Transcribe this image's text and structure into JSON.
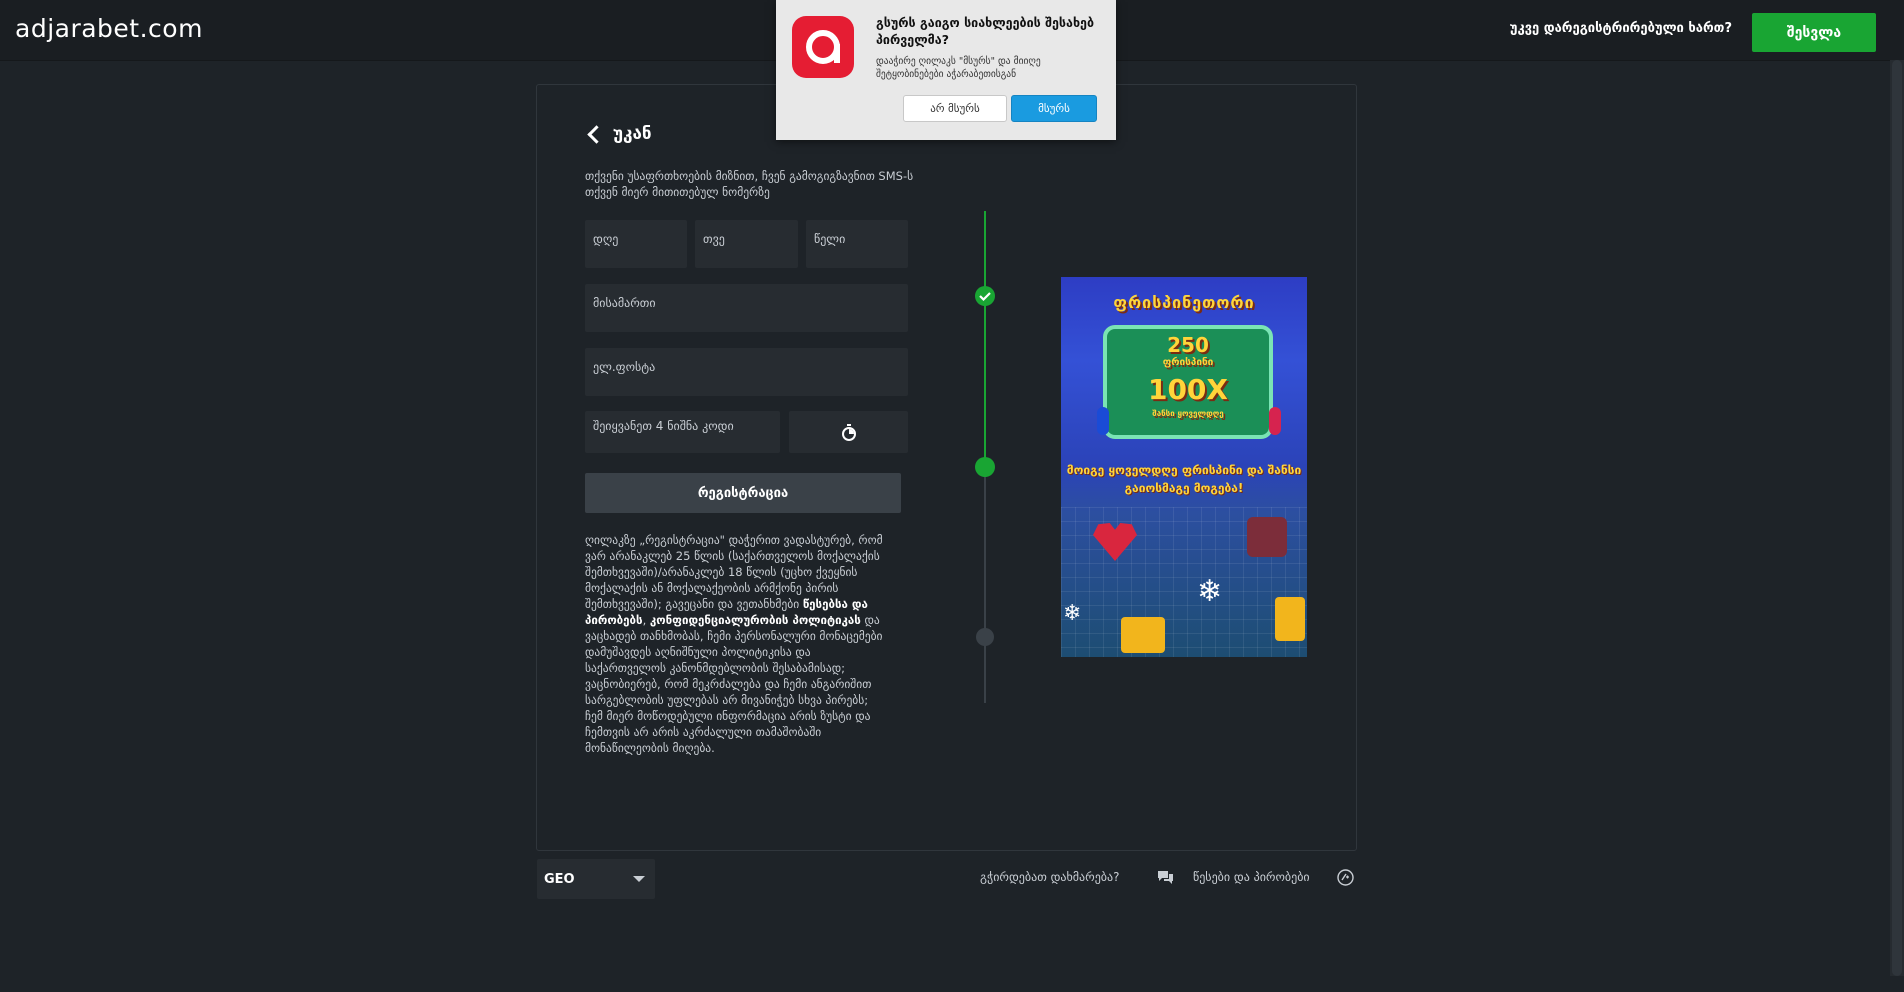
{
  "header": {
    "logo": "adjarabet.com",
    "already_registered": "უკვე დარეგისტრირებული ხართ?",
    "login_button": "შესვლა"
  },
  "form": {
    "back_label": "უკან",
    "info_text": "თქვენი უსაფრთხოების მიზნით, ჩვენ გამოგიგზავნით SMS-ს თქვენ მიერ მითითებულ ნომერზე",
    "day_placeholder": "დღე",
    "month_placeholder": "თვე",
    "year_placeholder": "წელი",
    "address_placeholder": "მისამართი",
    "email_placeholder": "ელ.ფოსტა",
    "code_placeholder": "შეიყვანეთ 4 ნიშნა კოდი",
    "register_button": "რეგისტრაცია",
    "legal": {
      "part1": "ღილაკზე „რეგისტრაცია\" დაჭერით ვადასტურებ, რომ ვარ არანაკლებ 25 წლის (საქართველოს მოქალაქის შემთხვევაში)/არანაკლებ 18 წლის (უცხო ქვეყნის მოქალაქის ან მოქალაქეობის არმქონე პირის შემთხვევაში); გავეცანი და ვეთანხმები ",
      "terms": "წესებსა და პირობებს",
      "sep": ", ",
      "privacy": "კონფიდენციალურობის პოლიტიკას",
      "part2": " და ვაცხადებ თანხმობას, ჩემი პერსონალური მონაცემები დამუშავდეს აღნიშნული პოლიტიკისა და საქართველოს კანონმდებლობის შესაბამისად; ვაცნობიერებ, რომ მეკრძალება და ჩემი ანგარიშით სარგებლობის უფლებას არ მივანიჭებ სხვა პირებს; ჩემ მიერ მოწოდებული ინფორმაცია არის ზუსტი და ჩემთვის არ არის აკრძალული თამაშობაში მონაწილეობის მიღება."
    }
  },
  "banner": {
    "title": "ფრისპინეთორი",
    "line1": "250",
    "line2": "ფრისპინი",
    "line3": "100X",
    "line4": "შანსი ყოველდღე",
    "subtitle": "მოიგე ყოველდღე ფრისპინი და შანსი გაიოსმაგე მოგება!"
  },
  "footer": {
    "language": "GEO",
    "help": "გჭირდებათ დახმარება?",
    "terms": "წესები და პირობები"
  },
  "popup": {
    "title": "გსურს გაიგო სიახლეების შესახებ პირველმა?",
    "text": "დააჭირე ღილაკს \"მსურს\" და მიიღე შეტყობინებები აჭარაბეთისგან",
    "decline": "არ მსურს",
    "accept": "მსურს"
  },
  "colors": {
    "accent_green": "#19a533",
    "accept_blue": "#1a9be0",
    "brand_red": "#e51d33"
  }
}
